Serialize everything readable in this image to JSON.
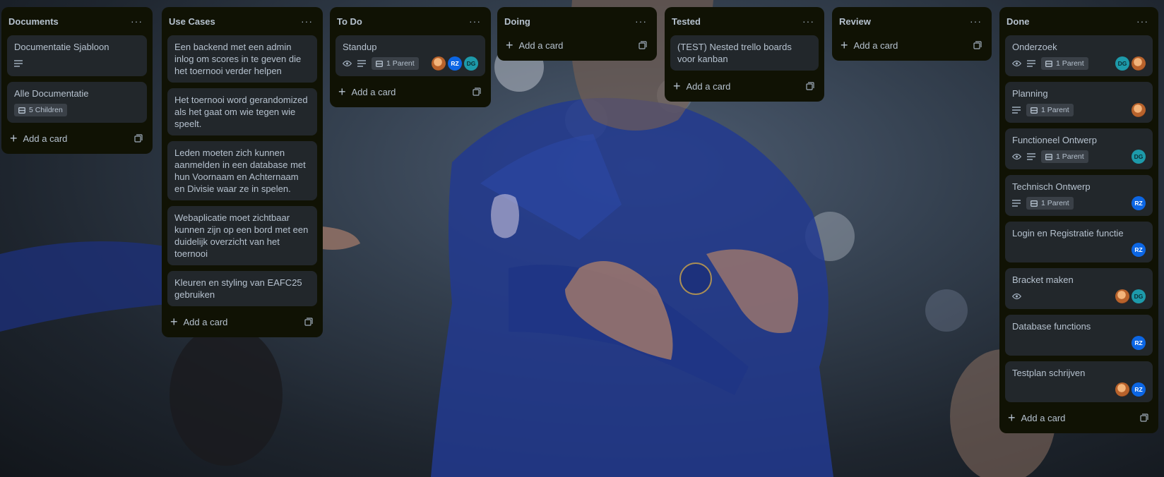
{
  "board": {
    "add_card_label": "Add a card",
    "lists": {
      "documents": {
        "title": "Documents",
        "cards": [
          {
            "title": "Documentatie Sjabloon"
          },
          {
            "title": "Alle Documentatie",
            "badge": "5 Children"
          }
        ]
      },
      "use_cases": {
        "title": "Use Cases",
        "cards": [
          {
            "title": "Een backend met een admin inlog om scores in te geven die het toernooi verder helpen"
          },
          {
            "title": "Het toernooi word gerandomized als het gaat om wie tegen wie speelt."
          },
          {
            "title": "Leden moeten zich kunnen aanmelden in een database met hun Voornaam en Achternaam en Divisie waar ze in spelen."
          },
          {
            "title": "Webaplicatie moet zichtbaar kunnen zijn op een bord met een duidelijk overzicht van het toernooi"
          },
          {
            "title": "Kleuren en styling van EAFC25 gebruiken"
          }
        ]
      },
      "todo": {
        "title": "To Do",
        "cards": [
          {
            "title": "Standup",
            "badge": "1 Parent",
            "avatars": [
              "RZ",
              "DG"
            ]
          }
        ]
      },
      "doing": {
        "title": "Doing"
      },
      "tested": {
        "title": "Tested",
        "cards": [
          {
            "title": "(TEST) Nested trello boards voor kanban"
          }
        ]
      },
      "review": {
        "title": "Review"
      },
      "done": {
        "title": "Done",
        "cards": [
          {
            "title": "Onderzoek",
            "badge": "1 Parent",
            "avatars": [
              "DG"
            ]
          },
          {
            "title": "Planning",
            "badge": "1 Parent"
          },
          {
            "title": "Functioneel Ontwerp",
            "badge": "1 Parent",
            "avatars": [
              "DG"
            ]
          },
          {
            "title": "Technisch Ontwerp",
            "badge": "1 Parent",
            "avatars": [
              "RZ"
            ]
          },
          {
            "title": "Login en Registratie functie",
            "avatars": [
              "RZ"
            ]
          },
          {
            "title": "Bracket maken",
            "avatars": [
              "DG"
            ]
          },
          {
            "title": "Database functions",
            "avatars": [
              "RZ"
            ]
          },
          {
            "title": "Testplan schrijven",
            "avatars": [
              "RZ"
            ]
          }
        ]
      }
    }
  },
  "icons": {
    "menu": "more-horizontal-icon",
    "template": "card-template-icon",
    "watch": "eye-icon",
    "description": "description-icon",
    "parent": "linked-card-icon",
    "add": "plus-icon"
  },
  "colors": {
    "list_bg": "#101204",
    "card_bg": "#22272b",
    "text": "#b6c2cf",
    "avatar_rz": "#0c66e4",
    "avatar_dg": "#1d9aaa"
  }
}
